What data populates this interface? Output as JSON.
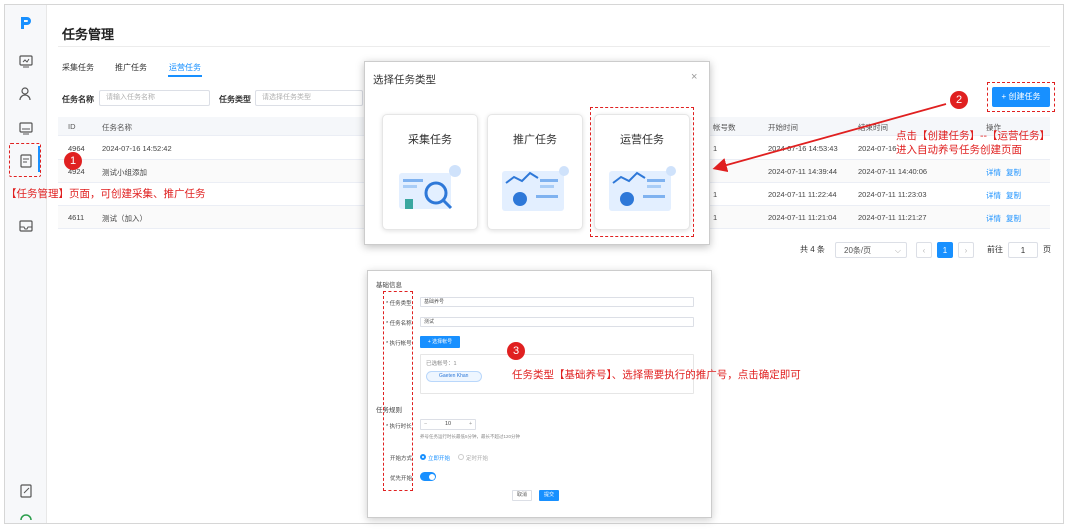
{
  "page": {
    "title": "任务管理"
  },
  "tabs": [
    {
      "label": "采集任务"
    },
    {
      "label": "推广任务"
    },
    {
      "label": "运营任务"
    }
  ],
  "filters": {
    "name_label": "任务名称",
    "name_placeholder": "请输入任务名称",
    "type_label": "任务类型",
    "type_placeholder": "请选择任务类型"
  },
  "create_button": {
    "label": "+ 创建任务"
  },
  "table": {
    "headers": [
      "ID",
      "任务名称",
      "帐号数",
      "开始时间",
      "结束时间",
      "操作"
    ],
    "rows": [
      {
        "id": "4964",
        "name": "2024-07-16 14:52:42",
        "accounts": "1",
        "start": "2024-07-16 14:53:43",
        "end": "2024-07-16",
        "actions": []
      },
      {
        "id": "4924",
        "name": "测试小组添加",
        "accounts": "",
        "start": "2024-07-11 14:39:44",
        "end": "2024-07-11 14:40:06",
        "actions": [
          "详情",
          "复制"
        ]
      },
      {
        "id": "",
        "name": "",
        "accounts": "1",
        "start": "2024-07-11 11:22:44",
        "end": "2024-07-11 11:23:03",
        "actions": [
          "详情",
          "复制"
        ]
      },
      {
        "id": "4611",
        "name": "测试（加入）",
        "accounts": "1",
        "start": "2024-07-11 11:21:04",
        "end": "2024-07-11 11:21:27",
        "actions": [
          "详情",
          "复制"
        ]
      }
    ]
  },
  "pagination": {
    "total": "共 4 条",
    "page_size": "20条/页",
    "current": "1",
    "goto_label": "前往",
    "goto_value": "1",
    "page_suffix": "页"
  },
  "modal": {
    "title": "选择任务类型",
    "close": "×",
    "cards": [
      {
        "label": "采集任务"
      },
      {
        "label": "推广任务"
      },
      {
        "label": "运营任务"
      }
    ]
  },
  "form": {
    "section_basic": "基础信息",
    "task_type_label": "* 任务类型",
    "task_type_value": "基础养号",
    "task_name_label": "* 任务名称",
    "task_name_value": "测试",
    "exec_account_label": "* 执行帐号",
    "select_account_button": "+ 选择帐号",
    "selected_count": "已选帐号：1",
    "account_tag": "Gaeten Khan",
    "section_rules": "任务规则",
    "duration_label": "* 执行时长",
    "duration_value": "10",
    "duration_hint": "养号任务运行时长最低5分钟，最长不超过120分钟",
    "start_mode_label": "开始方式",
    "start_now": "立即开始",
    "start_timed": "定时开始",
    "priority_label": "优先开始",
    "cancel_button": "取消",
    "submit_button": "提交"
  },
  "annotations": {
    "step1": "1",
    "step2": "2",
    "step3": "3",
    "note1": "【任务管理】页面，可创建采集、推广任务",
    "note2_line1": "点击【创建任务】--【运营任务】",
    "note2_line2": "进入自动养号任务创建页面",
    "note3": "任务类型【基础养号】、选择需要执行的推广号，点击确定即可"
  },
  "colors": {
    "accent": "#1890ff",
    "annotation": "#e02020"
  }
}
